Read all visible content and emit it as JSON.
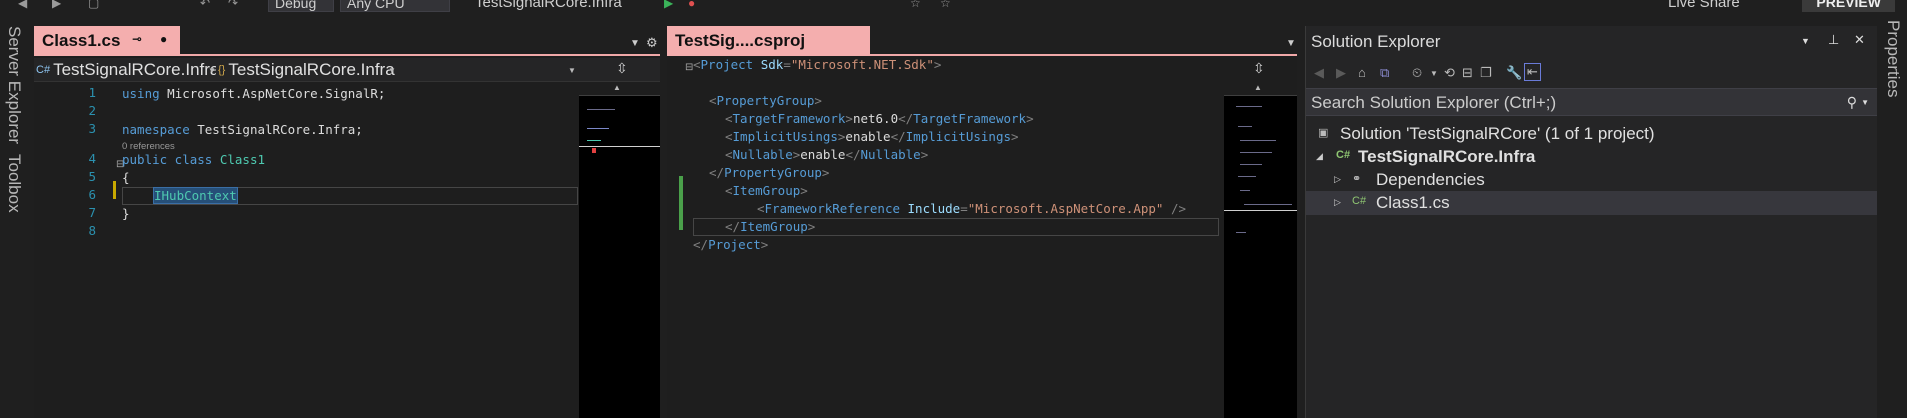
{
  "toolbar": {
    "config_label": "Debug",
    "platform_label": "Any CPU",
    "startup_project": "TestSignalRCore.Infra",
    "live_share_label": "Live Share",
    "preview_label": "PREVIEW"
  },
  "left_strip": {
    "server_explorer": "Server Explorer",
    "toolbox": "Toolbox"
  },
  "right_strip": {
    "properties": "Properties"
  },
  "editor1": {
    "tab_title": "Class1.cs",
    "nav_left": "TestSignalRCore.Infra",
    "nav_right": "TestSignalRCore.Infra",
    "line_numbers": [
      "1",
      "2",
      "3",
      "4",
      "5",
      "6",
      "7",
      "8"
    ],
    "codelens": "0 references",
    "code": {
      "l1_kw": "using",
      "l1_rest": " Microsoft.AspNetCore.SignalR;",
      "l3_kw": "namespace",
      "l3_rest": " TestSignalRCore.Infra;",
      "l4_kw": "public class",
      "l4_type": "Class1",
      "l5": "{",
      "l6_type": "IHubContext",
      "l7": "}"
    }
  },
  "editor2": {
    "tab_title": "TestSig....csproj",
    "code": {
      "project_tag": "Project",
      "sdk_attr": "Sdk",
      "sdk_val": "\"Microsoft.NET.Sdk\"",
      "property_group": "PropertyGroup",
      "target_framework": "TargetFramework",
      "target_framework_val": "net6.0",
      "implicit_usings": "ImplicitUsings",
      "implicit_usings_val": "enable",
      "nullable": "Nullable",
      "nullable_val": "enable",
      "item_group": "ItemGroup",
      "framework_reference": "FrameworkReference",
      "include_attr": "Include",
      "include_val": "\"Microsoft.AspNetCore.App\""
    }
  },
  "solution_explorer": {
    "title": "Solution Explorer",
    "search_placeholder": "Search Solution Explorer (Ctrl+;)",
    "items": [
      {
        "label": "Solution 'TestSignalRCore' (1 of 1 project)"
      },
      {
        "label": "TestSignalRCore.Infra"
      },
      {
        "label": "Dependencies"
      },
      {
        "label": "Class1.cs"
      }
    ]
  },
  "colors": {
    "tab_active": "#f4aeae",
    "keyword": "#569cd6",
    "type": "#4ec9b0",
    "line_number": "#2b91af",
    "string": "#ce9178",
    "attribute": "#9cdcfe"
  }
}
